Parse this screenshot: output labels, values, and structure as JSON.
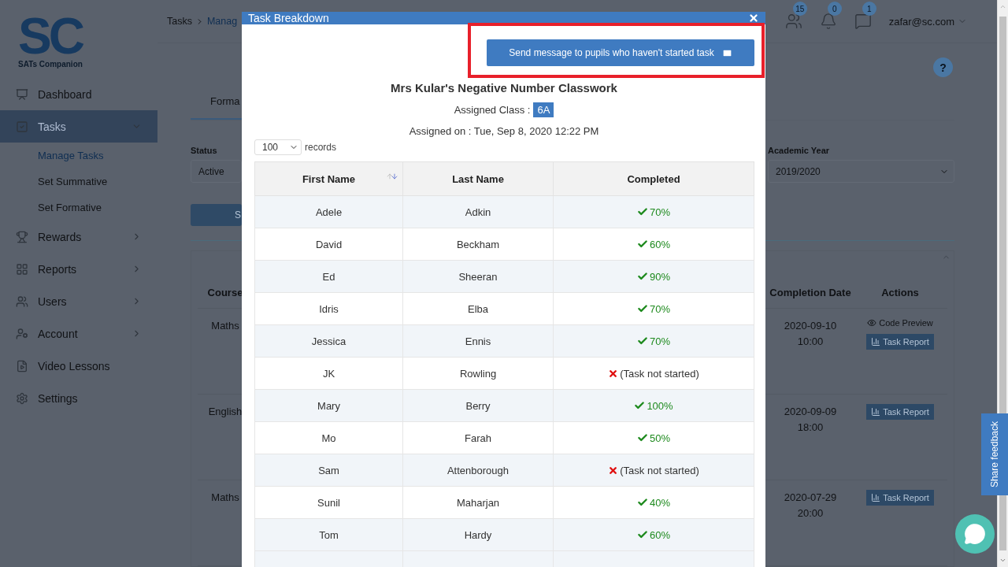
{
  "sidebar": {
    "logo": {
      "mark": "SC",
      "name": "SATs Companion"
    },
    "items": [
      {
        "label": "Dashboard",
        "kind": "link"
      },
      {
        "label": "Tasks",
        "kind": "menu",
        "expanded": true,
        "selected": true,
        "children": [
          {
            "label": "Manage Tasks",
            "selected": true
          },
          {
            "label": "Set Summative",
            "selected": false
          },
          {
            "label": "Set Formative",
            "selected": false
          }
        ]
      },
      {
        "label": "Rewards",
        "kind": "menu",
        "expanded": false,
        "selected": false
      },
      {
        "label": "Reports",
        "kind": "menu",
        "expanded": false,
        "selected": false
      },
      {
        "label": "Users",
        "kind": "menu",
        "expanded": false,
        "selected": false
      },
      {
        "label": "Account",
        "kind": "menu",
        "expanded": false,
        "selected": false
      },
      {
        "label": "Video Lessons",
        "kind": "link"
      },
      {
        "label": "Settings",
        "kind": "link"
      }
    ]
  },
  "header": {
    "breadcrumb": [
      "Tasks",
      "Manag"
    ],
    "badges": [
      "15",
      "0",
      "1"
    ],
    "user": "zafar@sc.com"
  },
  "page": {
    "help": "?",
    "tab": "Forma",
    "filters": [
      {
        "label": "Status",
        "value": "Active"
      },
      {
        "label": "Academic Year",
        "value": "2019/2020"
      }
    ],
    "button": "S",
    "table": {
      "columns": [
        "Course",
        "Completion Date",
        "Actions"
      ],
      "rows": [
        {
          "course": "Maths",
          "date": [
            "2020-09-10",
            "10:00"
          ],
          "preview": "Code Preview",
          "report": "Task Report"
        },
        {
          "course": "English",
          "date": [
            "2020-09-09",
            "18:00"
          ],
          "report": "Task Report"
        },
        {
          "course": "Maths",
          "date": [
            "2020-07-29",
            "20:00"
          ],
          "report": "Task Report"
        }
      ]
    }
  },
  "modal": {
    "title": "Task Breakdown",
    "send_button": {
      "label": "Send message to pupils who haven't started task",
      "highlighted": true
    },
    "task_title": "Mrs Kular's Negative Number Classwork",
    "class_label": "Assigned Class :",
    "class": "6A",
    "assigned": "Assigned on : Tue, Sep 8, 2020 12:22 PM",
    "page_size": "100",
    "page_size_label": "records",
    "columns": [
      "First Name",
      "Last Name",
      "Completed"
    ],
    "rows": [
      {
        "first": "Adele",
        "last": "Adkin",
        "kind": "done",
        "completed": "70%"
      },
      {
        "first": "David",
        "last": "Beckham",
        "kind": "done",
        "completed": "60%"
      },
      {
        "first": "Ed",
        "last": "Sheeran",
        "kind": "done",
        "completed": "90%"
      },
      {
        "first": "Idris",
        "last": "Elba",
        "kind": "done",
        "completed": "70%"
      },
      {
        "first": "Jessica",
        "last": "Ennis",
        "kind": "done",
        "completed": "70%"
      },
      {
        "first": "JK",
        "last": "Rowling",
        "kind": "not_started",
        "completed": "(Task not started)"
      },
      {
        "first": "Mary",
        "last": "Berry",
        "kind": "done",
        "completed": "100%"
      },
      {
        "first": "Mo",
        "last": "Farah",
        "kind": "done",
        "completed": "50%"
      },
      {
        "first": "Sam",
        "last": "Attenborough",
        "kind": "not_started",
        "completed": "(Task not started)"
      },
      {
        "first": "Sunil",
        "last": "Maharjan",
        "kind": "done",
        "completed": "40%"
      },
      {
        "first": "Tom",
        "last": "Hardy",
        "kind": "done",
        "completed": "60%"
      }
    ]
  },
  "feedback_tab": "Share feedback"
}
